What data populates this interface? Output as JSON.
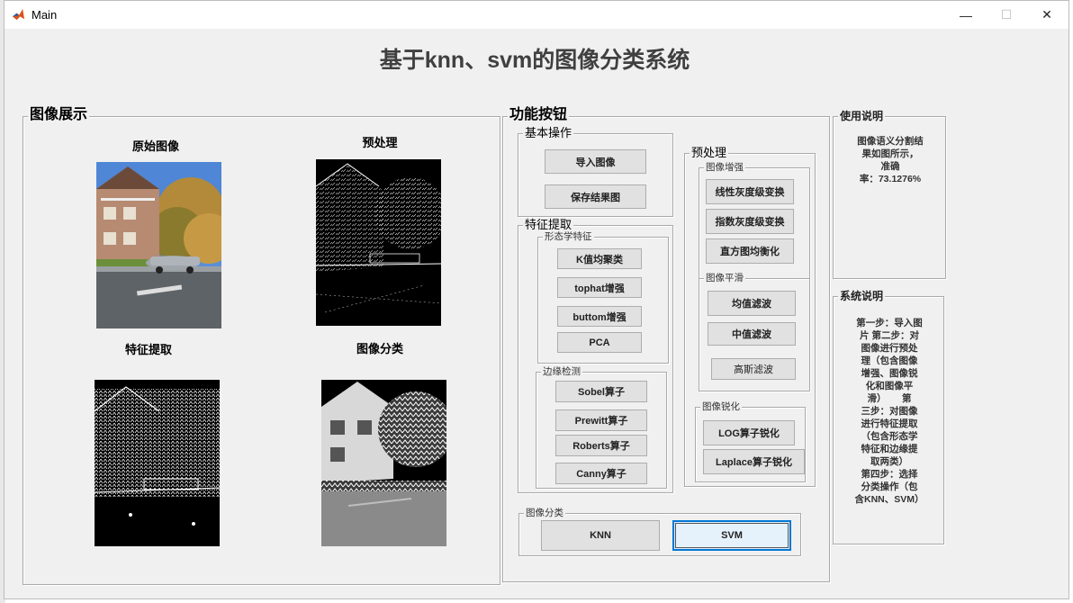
{
  "window": {
    "title": "Main",
    "minimize": "—",
    "maximize": "☐",
    "close": "✕"
  },
  "page_title": "基于knn、svm的图像分类系统",
  "display_panel": {
    "label": "图像展示",
    "original": "原始图像",
    "preprocess": "预处理",
    "feature": "特征提取",
    "classify": "图像分类"
  },
  "function_panel": {
    "label": "功能按钮",
    "basic": {
      "label": "基本操作",
      "import": "导入图像",
      "save": "保存结果图"
    },
    "feature": {
      "label": "特征提取",
      "morph": {
        "label": "形态学特征",
        "kmeans": "K值均聚类",
        "tophat": "tophat增强",
        "buttom": "buttom增强",
        "pca": "PCA"
      },
      "edge": {
        "label": "边缘检测",
        "sobel": "Sobel算子",
        "prewitt": "Prewitt算子",
        "roberts": "Roberts算子",
        "canny": "Canny算子"
      }
    },
    "preprocess": {
      "label": "预处理",
      "enhance": {
        "label": "图像增强",
        "linear": "线性灰度级变换",
        "exp": "指数灰度级变换",
        "hist": "直方图均衡化"
      },
      "smooth": {
        "label": "图像平滑",
        "mean": "均值滤波",
        "median": "中值滤波",
        "gauss": "高斯滤波"
      },
      "sharpen": {
        "label": "图像锐化",
        "log": "LOG算子锐化",
        "laplace": "Laplace算子锐化"
      }
    },
    "classify": {
      "label": "图像分类",
      "knn": "KNN",
      "svm": "SVM"
    }
  },
  "usage": {
    "label": "使用说明",
    "lines": [
      "图像语义分割结",
      "果如图所示，",
      "准确",
      "率：73.1276%"
    ]
  },
  "system": {
    "label": "系统说明",
    "lines": [
      "第一步：导入图",
      "片 第二步：对",
      "图像进行预处",
      "理（包含图像",
      "增强、图像锐",
      "化和图像平",
      "滑）      第",
      "三步：对图像",
      "进行特征提取",
      "（包含形态学",
      "特征和边缘提",
      "取两类）",
      "第四步：选择",
      "分类操作（包",
      "含KNN、SVM）"
    ]
  }
}
